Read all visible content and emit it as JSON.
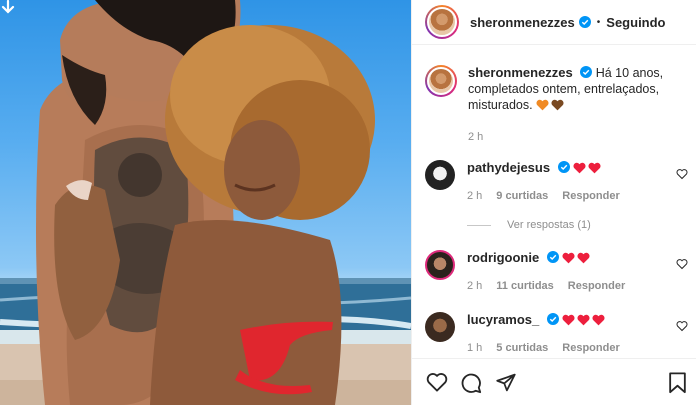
{
  "post": {
    "author": "sheronmenezzes",
    "follow_status": "Seguindo",
    "caption_author": "sheronmenezzes",
    "caption_text": "Há 10 anos, completados ontem, entrelaçados, misturados.",
    "caption_time": "2 h"
  },
  "comments": [
    {
      "username": "pathydejesus",
      "verified": true,
      "hearts": 2,
      "time": "2 h",
      "likes": "9 curtidas",
      "reply": "Responder",
      "view_replies": "Ver respostas (1)"
    },
    {
      "username": "rodrigoonie",
      "verified": true,
      "hearts": 2,
      "time": "2 h",
      "likes": "11 curtidas",
      "reply": "Responder"
    },
    {
      "username": "lucyramos_",
      "verified": true,
      "hearts": 3,
      "time": "1 h",
      "likes": "5 curtidas",
      "reply": "Responder"
    }
  ],
  "colors": {
    "verified": "#0095f6",
    "heart_red": "#ed1f3d",
    "heart_orange": "#f08a24",
    "heart_brown": "#7a4a22",
    "muted_text": "#8e8e8e"
  },
  "icons": [
    "download-arrow-icon",
    "verified-badge-icon",
    "heart-icon",
    "comment-icon",
    "share-icon",
    "bookmark-icon"
  ]
}
